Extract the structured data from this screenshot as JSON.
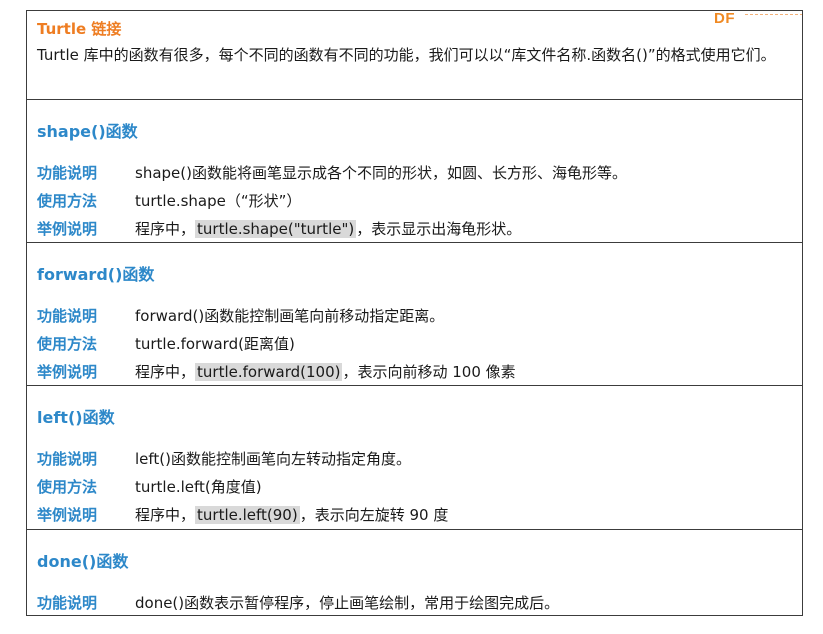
{
  "logo": {
    "text": "DF"
  },
  "intro": {
    "title": "Turtle 链接",
    "text": "Turtle 库中的函数有很多，每个不同的函数有不同的功能，我们可以以“库文件名称.函数名()”的格式使用它们。"
  },
  "colors": {
    "section_title": "#2d88c9",
    "intro_title": "#ee7d22",
    "logo": "#f08a24",
    "highlight": "#d9d9d9"
  },
  "sections": [
    {
      "title": "shape()函数",
      "rows": [
        {
          "label": "功能说明",
          "value": "shape()函数能将画笔显示成各个不同的形状，如圆、长方形、海龟形等。"
        },
        {
          "label": "使用方法",
          "value": "turtle.shape（“形状”）"
        },
        {
          "label": "举例说明",
          "prefix": "程序中，",
          "highlight": "turtle.shape(\"turtle\")",
          "suffix": "，表示显示出海龟形状。"
        }
      ]
    },
    {
      "title": "forward()函数",
      "rows": [
        {
          "label": "功能说明",
          "value": "forward()函数能控制画笔向前移动指定距离。"
        },
        {
          "label": "使用方法",
          "value": "turtle.forward(距离值)"
        },
        {
          "label": "举例说明",
          "prefix": "程序中，",
          "highlight": "turtle.forward(100)",
          "suffix": "，表示向前移动 100 像素"
        }
      ]
    },
    {
      "title": "left()函数",
      "rows": [
        {
          "label": "功能说明",
          "value": "left()函数能控制画笔向左转动指定角度。"
        },
        {
          "label": "使用方法",
          "value": "turtle.left(角度值)"
        },
        {
          "label": "举例说明",
          "prefix": "程序中，",
          "highlight": "turtle.left(90)",
          "suffix": "，表示向左旋转 90 度"
        }
      ]
    },
    {
      "title": "done()函数",
      "rows": [
        {
          "label": "功能说明",
          "value": "done()函数表示暂停程序，停止画笔绘制，常用于绘图完成后。"
        }
      ]
    }
  ]
}
